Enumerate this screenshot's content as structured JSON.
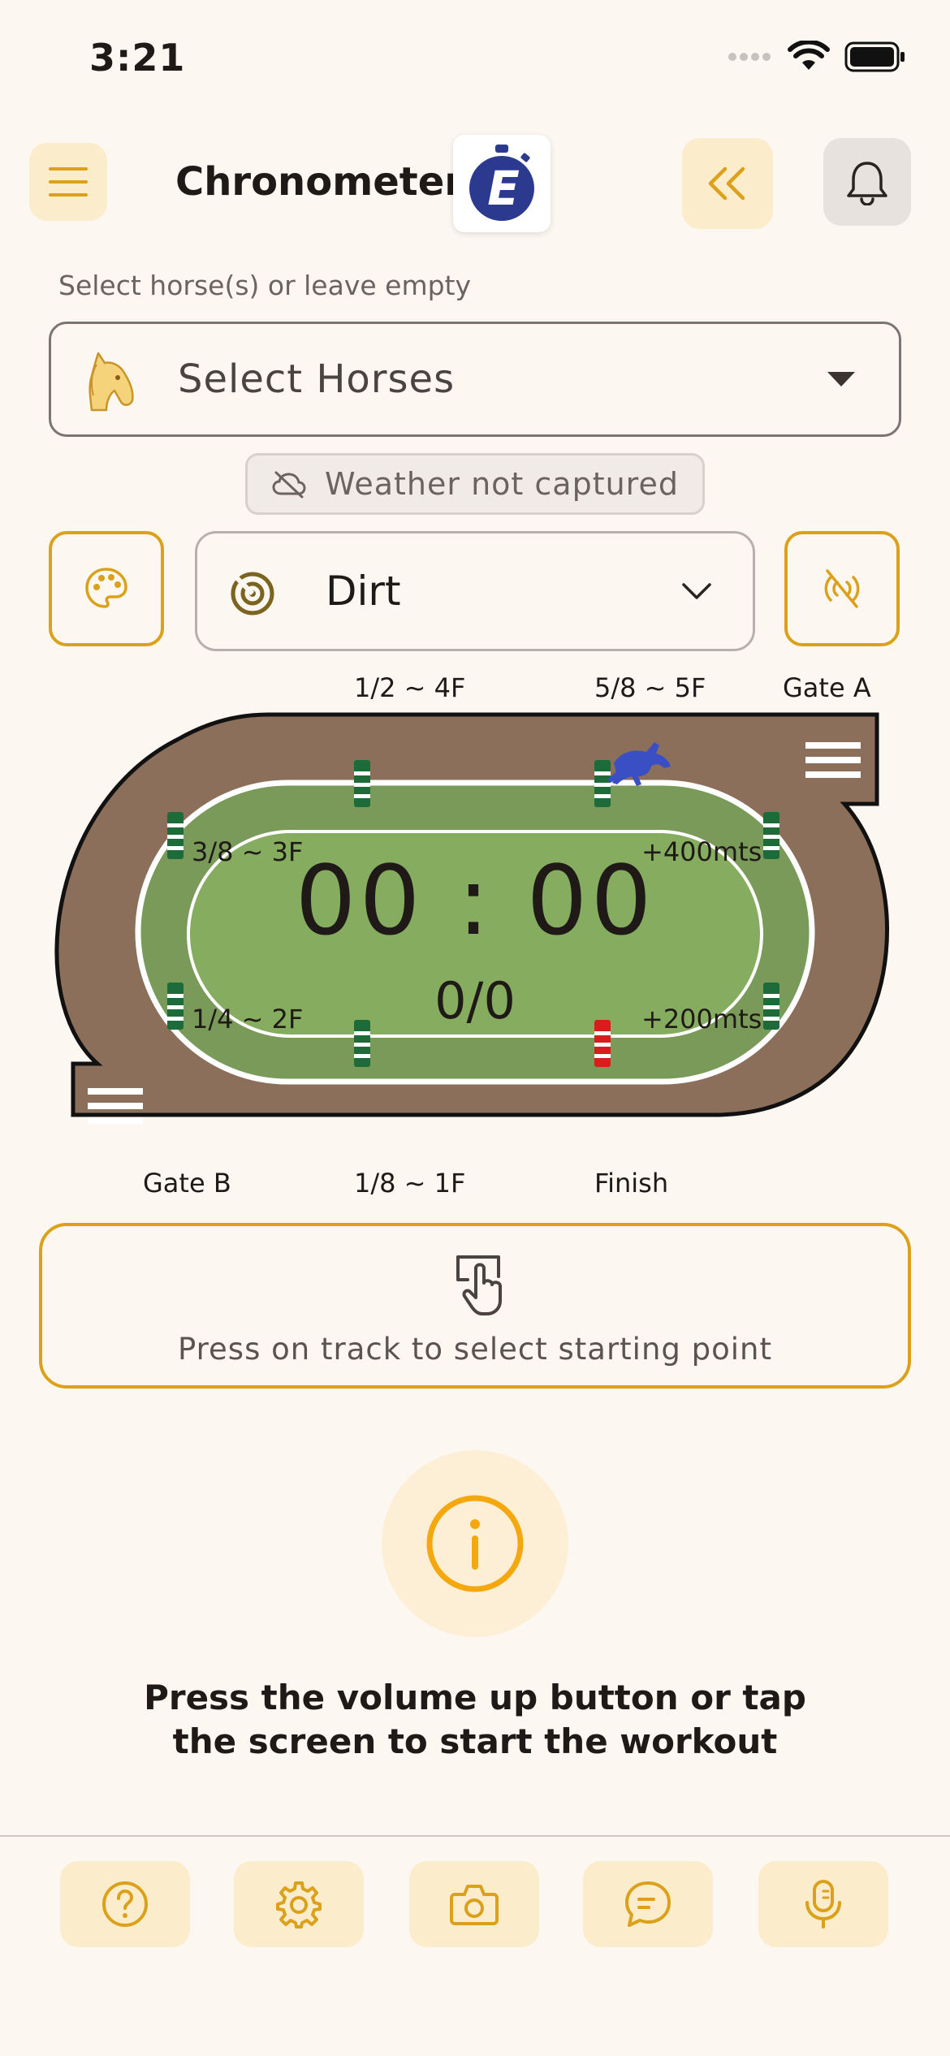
{
  "status_bar": {
    "time": "3:21"
  },
  "header": {
    "title": "Chronometer",
    "menu_icon": "hamburger-icon",
    "back_icon": "double-chevron-left-icon",
    "bell_icon": "bell-icon",
    "logo_letter": "E"
  },
  "horse_select": {
    "hint": "Select horse(s) or leave empty",
    "placeholder": "Select Horses"
  },
  "weather": {
    "status": "Weather not captured"
  },
  "surface": {
    "value": "Dirt"
  },
  "track": {
    "labels": {
      "half": "1/2 ~ 4F",
      "five_eighths": "5/8 ~ 5F",
      "gate_a": "Gate A",
      "three_eighths": "3/8 ~ 3F",
      "plus_400": "+400mts",
      "quarter": "1/4 ~ 2F",
      "plus_200": "+200mts",
      "gate_b": "Gate B",
      "eighth": "1/8 ~ 1F",
      "finish": "Finish"
    },
    "timer": "00 : 00",
    "count": "0/0"
  },
  "start_prompt": "Press on track to select starting point",
  "cta": {
    "line1": "Press the volume up button or tap",
    "line2": "the screen to start the workout"
  },
  "bottom_bar": [
    {
      "icon": "help-icon"
    },
    {
      "icon": "gear-icon"
    },
    {
      "icon": "camera-icon"
    },
    {
      "icon": "chat-icon"
    },
    {
      "icon": "microphone-icon"
    }
  ],
  "colors": {
    "accent": "#dba11a",
    "track_brown": "#8b6f5a",
    "infield_dark": "#7a9a5a",
    "infield_light": "#86ad5f",
    "logo_blue": "#2b3a8f"
  }
}
